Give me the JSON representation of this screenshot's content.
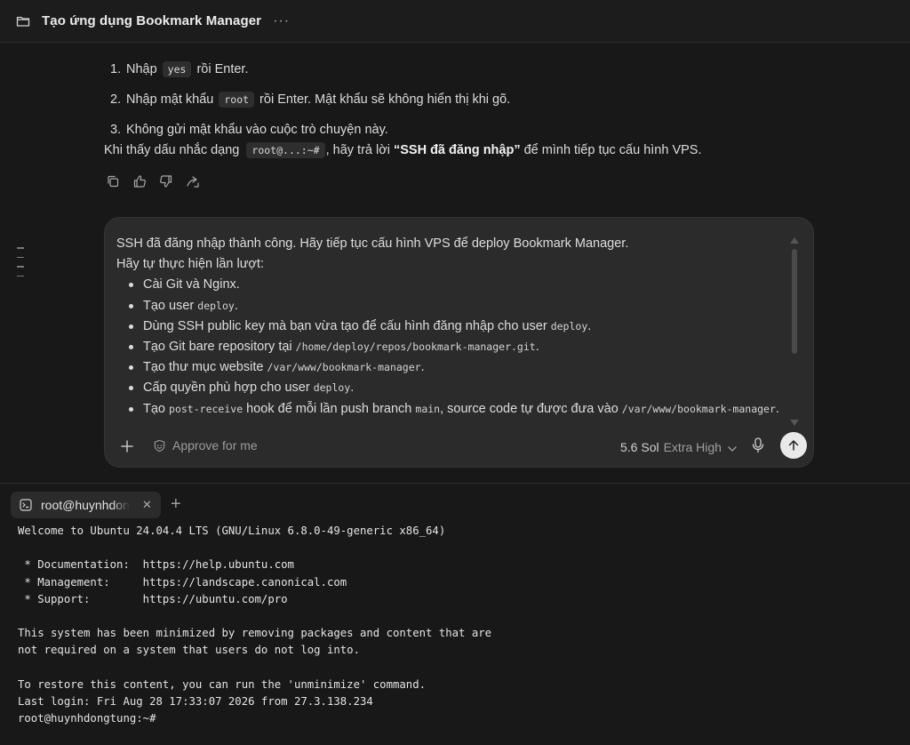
{
  "header": {
    "title": "Tạo ứng dụng Bookmark Manager",
    "more": "···"
  },
  "chat": {
    "steps": [
      {
        "num": "1.",
        "before": "Nhập",
        "code": "yes",
        "after": "rồi Enter."
      },
      {
        "num": "2.",
        "before": "Nhập mật khẩu",
        "code": "root",
        "after": "rồi Enter. Mật khẩu sẽ không hiển thị khi gõ."
      },
      {
        "num": "3.",
        "text": "Không gửi mật khẩu vào cuộc trò chuyện này."
      }
    ],
    "para": {
      "before": "Khi thấy dấu nhắc dạng",
      "code": "root@...:~#",
      "middle": ", hãy trả lời",
      "bold": "“SSH đã đăng nhập”",
      "after": "để mình tiếp tục cấu hình VPS."
    }
  },
  "composer": {
    "line1": "SSH đã đăng nhập thành công. Hãy tiếp tục cấu hình VPS để deploy Bookmark Manager.",
    "line2": "Hãy tự thực hiện lần lượt:",
    "items": [
      {
        "text": "Cài Git và Nginx."
      },
      {
        "text": "Tạo user",
        "code": "deploy",
        "tail": "."
      },
      {
        "text": "Dùng SSH public key mà bạn vừa tạo để cấu hình đăng nhập cho user",
        "code": "deploy",
        "tail": "."
      },
      {
        "text": "Tạo Git bare repository tại",
        "code": "/home/deploy/repos/bookmark-manager.git",
        "tail": "."
      },
      {
        "text": "Tạo thư mục website",
        "code": "/var/www/bookmark-manager",
        "tail": "."
      },
      {
        "text": "Cấp quyền phù hợp cho user",
        "code": "deploy",
        "tail": "."
      },
      {
        "text": "Tạo",
        "code": "post-receive",
        "mid": "hook để mỗi lần push branch",
        "code2": "main",
        "mid2": ", source code tự được đưa vào",
        "code3": "/var/www/bookmark-manager",
        "tail": "."
      }
    ],
    "approve_label": "Approve for me",
    "model": "5.6 Sol",
    "effort": "Extra High"
  },
  "terminal": {
    "tab_label": "root@huynhdongtung",
    "lines": [
      "Welcome to Ubuntu 24.04.4 LTS (GNU/Linux 6.8.0-49-generic x86_64)",
      "",
      " * Documentation:  https://help.ubuntu.com",
      " * Management:     https://landscape.canonical.com",
      " * Support:        https://ubuntu.com/pro",
      "",
      "This system has been minimized by removing packages and content that are",
      "not required on a system that users do not log into.",
      "",
      "To restore this content, you can run the 'unminimize' command.",
      "Last login: Fri Aug 28 17:33:07 2026 from 27.3.138.234",
      "root@huynhdongtung:~#"
    ]
  },
  "colors": {
    "background": "#181818",
    "composer": "#2b2b2b",
    "send_button": "#e9e9e9"
  },
  "icons": [
    "folder-icon",
    "copy-icon",
    "thumbs-up-icon",
    "thumbs-down-icon",
    "share-icon",
    "plus-icon",
    "approve-icon",
    "chevron-down-icon",
    "microphone-icon",
    "arrow-up-icon",
    "terminal-icon",
    "close-icon"
  ]
}
